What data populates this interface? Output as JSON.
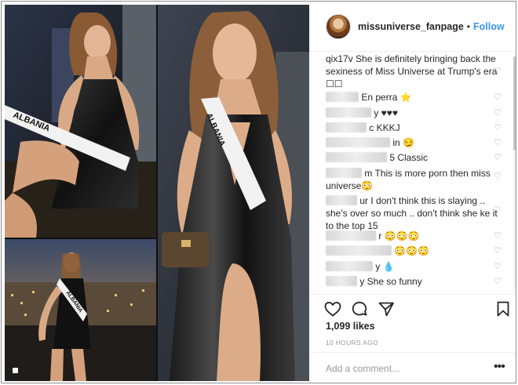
{
  "post": {
    "images": {
      "photo_1_sash": "ALBANIA",
      "photo_2_sash": "ALBANIA",
      "photo_3_sash": "ALBANIA"
    }
  },
  "header": {
    "username": "missuniverse_fanpage",
    "separator": "•",
    "follow_label": "Follow"
  },
  "comments": [
    {
      "user": "qix17v",
      "text": "She is definitely bringing back the sexiness of Miss Universe at Trump's era ☐☐"
    },
    {
      "user": "",
      "text": "En perra ⭐"
    },
    {
      "user": "",
      "text": "y ♥♥♥"
    },
    {
      "user": "",
      "text": "c KKKJ"
    },
    {
      "user": "",
      "text": "in 😏"
    },
    {
      "user": "",
      "text": "5 Classic"
    },
    {
      "user": "",
      "text": "m This is more porn then miss universe😳"
    },
    {
      "user": "",
      "text": "ur I don't think this is slaying .. she's over so much .. don't think she ke it to the top 15"
    },
    {
      "user": "",
      "text": "r 😳😳😳"
    },
    {
      "user": "",
      "text": "😳😳😳"
    },
    {
      "user": "",
      "text": "y 💧"
    },
    {
      "user": "",
      "text": "y She so funny"
    }
  ],
  "actions": {
    "like_icon": "heart-outline-icon",
    "comment_icon": "comment-bubble-icon",
    "share_icon": "share-icon",
    "save_icon": "bookmark-icon",
    "likes_label": "1,099 likes",
    "timestamp": "10 HOURS AGO"
  },
  "add_comment": {
    "placeholder": "Add a comment...",
    "more_label": "•••"
  },
  "colors": {
    "accent": "#3897f0",
    "text": "#262626",
    "muted": "#999999",
    "border": "#efefef"
  }
}
